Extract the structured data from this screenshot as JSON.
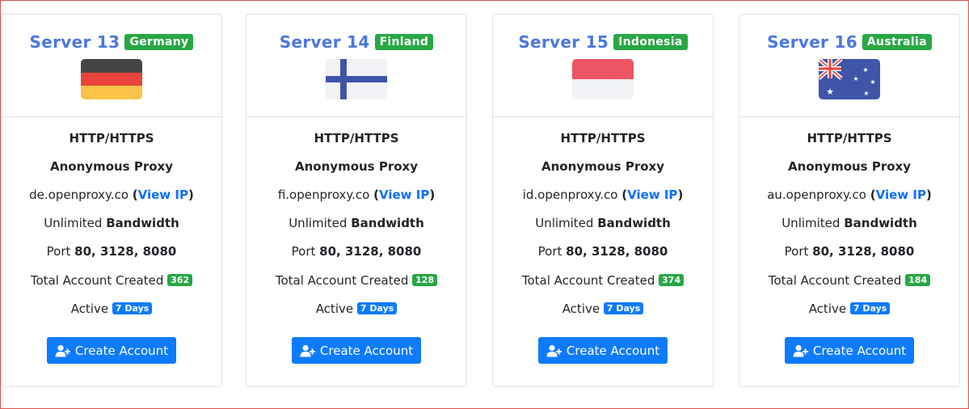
{
  "servers": [
    {
      "name": "Server 13",
      "country": "Germany",
      "protocol": "HTTP/HTTPS",
      "proxy_type": "Anonymous Proxy",
      "host": "de.openproxy.co",
      "view_ip": "View IP",
      "bandwidth_prefix": "Unlimited",
      "bandwidth_value": "Bandwidth",
      "port_prefix": "Port",
      "ports": "80, 3128, 8080",
      "accounts_label": "Total Account Created",
      "accounts_count": "362",
      "active_label": "Active",
      "active_badge": "7 Days",
      "button_label": "Create Account",
      "flag_icon": "germany-flag-icon"
    },
    {
      "name": "Server 14",
      "country": "Finland",
      "protocol": "HTTP/HTTPS",
      "proxy_type": "Anonymous Proxy",
      "host": "fi.openproxy.co",
      "view_ip": "View IP",
      "bandwidth_prefix": "Unlimited",
      "bandwidth_value": "Bandwidth",
      "port_prefix": "Port",
      "ports": "80, 3128, 8080",
      "accounts_label": "Total Account Created",
      "accounts_count": "128",
      "active_label": "Active",
      "active_badge": "7 Days",
      "button_label": "Create Account",
      "flag_icon": "finland-flag-icon"
    },
    {
      "name": "Server 15",
      "country": "Indonesia",
      "protocol": "HTTP/HTTPS",
      "proxy_type": "Anonymous Proxy",
      "host": "id.openproxy.co",
      "view_ip": "View IP",
      "bandwidth_prefix": "Unlimited",
      "bandwidth_value": "Bandwidth",
      "port_prefix": "Port",
      "ports": "80, 3128, 8080",
      "accounts_label": "Total Account Created",
      "accounts_count": "374",
      "active_label": "Active",
      "active_badge": "7 Days",
      "button_label": "Create Account",
      "flag_icon": "indonesia-flag-icon"
    },
    {
      "name": "Server 16",
      "country": "Australia",
      "protocol": "HTTP/HTTPS",
      "proxy_type": "Anonymous Proxy",
      "host": "au.openproxy.co",
      "view_ip": "View IP",
      "bandwidth_prefix": "Unlimited",
      "bandwidth_value": "Bandwidth",
      "port_prefix": "Port",
      "ports": "80, 3128, 8080",
      "accounts_label": "Total Account Created",
      "accounts_count": "184",
      "active_label": "Active",
      "active_badge": "7 Days",
      "button_label": "Create Account",
      "flag_icon": "australia-flag-icon"
    }
  ],
  "colors": {
    "title": "#4a77e0",
    "green_badge": "#28a745",
    "blue_badge": "#0d7bfd",
    "link": "#0d6efd",
    "button": "#0d7bfd",
    "frame_border": "#d9534f"
  }
}
